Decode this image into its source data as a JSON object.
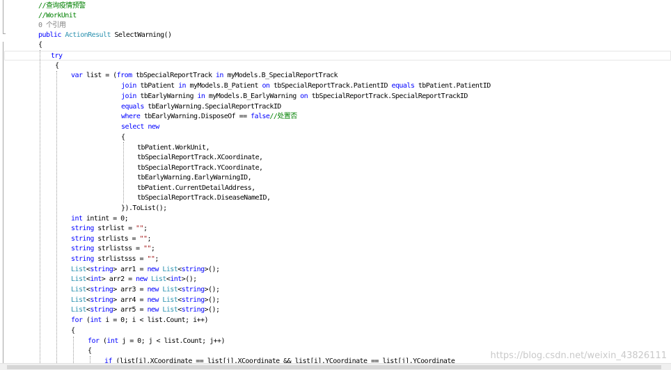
{
  "editor": {
    "code_lines": [
      "//查询疫情预警",
      "//WorkUnit",
      "0 个引用",
      "public ActionResult SelectWarning()",
      "{",
      "try",
      "{",
      "var list = (from tbSpecialReportTrack in myModels.B_SpecialReportTrack",
      "join tbPatient in myModels.B_Patient on tbSpecialReportTrack.PatientID equals tbPatient.PatientID",
      "join tbEarlyWarning in myModels.B_EarlyWarning on tbSpecialReportTrack.SpecialReportTrackID",
      "equals tbEarlyWarning.SpecialReportTrackID",
      "where tbEarlyWarning.DisposeOf == false//处置否",
      "select new",
      "{",
      "tbPatient.WorkUnit,",
      "tbSpecialReportTrack.XCoordinate,",
      "tbSpecialReportTrack.YCoordinate,",
      "tbEarlyWarning.EarlyWarningID,",
      "tbPatient.CurrentDetailAddress,",
      "tbSpecialReportTrack.DiseaseNameID,",
      "}).ToList();",
      "int intint = 0;",
      "string strlist = \"\";",
      "string strlists = \"\";",
      "string strlistss = \"\";",
      "string strlistsss = \"\";",
      "List<string> arr1 = new List<string>();",
      "List<int> arr2 = new List<int>();",
      "List<string> arr3 = new List<string>();",
      "List<string> arr4 = new List<string>();",
      "List<string> arr5 = new List<string>();",
      "for (int i = 0; i < list.Count; i++)",
      "{",
      "for (int j = 0; j < list.Count; j++)",
      "{",
      "if (list[i].XCoordinate == list[j].XCoordinate && list[i].YCoordinate == list[j].YCoordinate"
    ]
  },
  "watermark": "https://blog.csdn.net/weixin_43826111",
  "colors": {
    "keyword": "#0000ff",
    "type": "#2b91af",
    "comment": "#008000",
    "string": "#a31515",
    "codelens": "#808080",
    "text": "#000000"
  }
}
